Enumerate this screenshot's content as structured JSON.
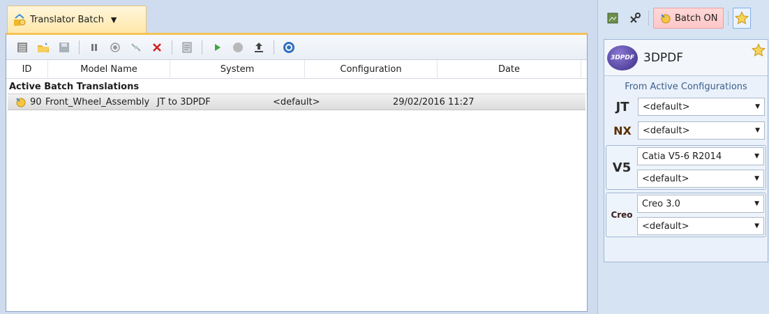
{
  "window": {
    "tab_title": "Translator Batch",
    "tab_caret": "▼"
  },
  "table": {
    "columns": [
      "ID",
      "Model Name",
      "System",
      "Configuration",
      "Date"
    ],
    "group_title": "Active Batch Translations",
    "rows": [
      {
        "id": "90",
        "model": "Front_Wheel_Assembly",
        "system": "JT to 3DPDF",
        "configuration": "<default>",
        "date": "29/02/2016 11:27"
      }
    ]
  },
  "right_toolbar": {
    "batch_label": "Batch ON"
  },
  "panel": {
    "logo_text": "3DPDF",
    "title": "3DPDF",
    "subtitle": "From Active Configurations",
    "jt": {
      "label": "JT",
      "value": "<default>"
    },
    "nx": {
      "label": "NX",
      "value": "<default>"
    },
    "v5": {
      "label": "V5",
      "values": [
        "Catia V5-6 R2014",
        "<default>"
      ]
    },
    "creo": {
      "label": "Creo",
      "values": [
        "Creo 3.0",
        "<default>"
      ]
    }
  },
  "colors": {
    "tab_active": "#ffe7a8",
    "batch_on": "#ffc7c7",
    "panel_bg": "#eaf1fa"
  },
  "icons": [
    "translator-batch-icon",
    "list-icon",
    "open-folder-icon",
    "save-icon",
    "pause-icon",
    "record-icon",
    "disconnect-icon",
    "delete-icon",
    "properties-icon",
    "play-icon",
    "stop-icon",
    "export-icon",
    "refresh-icon",
    "map-icon",
    "tools-icon",
    "batch-icon",
    "star-icon"
  ]
}
